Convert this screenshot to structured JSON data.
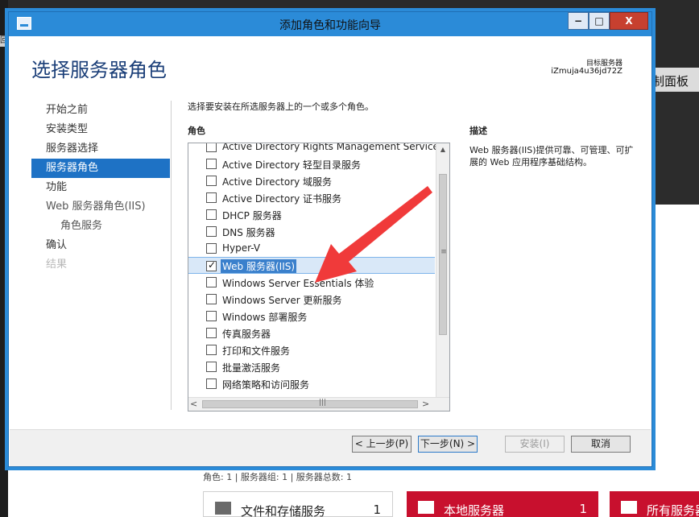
{
  "background": {
    "left_fragment": "回",
    "panel_label": "制面板",
    "summary": "角色: 1 | 服务器组: 1 | 服务器总数: 1",
    "tiles": [
      {
        "title": "文件和存储服务",
        "count": "1"
      },
      {
        "title": "本地服务器",
        "count": "1"
      },
      {
        "title": "所有服务器",
        "count": ""
      }
    ]
  },
  "window": {
    "title": "添加角色和功能向导",
    "controls": {
      "minimize": "−",
      "maximize": "□",
      "close": "X"
    }
  },
  "page": {
    "heading": "选择服务器角色",
    "target_label": "目标服务器",
    "target_name": "iZmuja4u36jd72Z"
  },
  "nav": {
    "items": [
      {
        "label": "开始之前",
        "state": "normal"
      },
      {
        "label": "安装类型",
        "state": "normal"
      },
      {
        "label": "服务器选择",
        "state": "normal"
      },
      {
        "label": "服务器角色",
        "state": "active"
      },
      {
        "label": "功能",
        "state": "normal"
      },
      {
        "label": "Web 服务器角色(IIS)",
        "state": "normal"
      },
      {
        "label": "角色服务",
        "state": "sub"
      },
      {
        "label": "确认",
        "state": "normal"
      },
      {
        "label": "结果",
        "state": "disabled"
      }
    ]
  },
  "content": {
    "instruction": "选择要安装在所选服务器上的一个或多个角色。",
    "roles_header": "角色",
    "description_header": "描述",
    "description": "Web 服务器(IIS)提供可靠、可管理、可扩展的 Web 应用程序基础结构。",
    "roles": [
      {
        "label": "Active Directory Rights Management Services",
        "checked": false
      },
      {
        "label": "Active Directory 轻型目录服务",
        "checked": false
      },
      {
        "label": "Active Directory 域服务",
        "checked": false
      },
      {
        "label": "Active Directory 证书服务",
        "checked": false
      },
      {
        "label": "DHCP 服务器",
        "checked": false
      },
      {
        "label": "DNS 服务器",
        "checked": false
      },
      {
        "label": "Hyper-V",
        "checked": false
      },
      {
        "label": "Web 服务器(IIS)",
        "checked": true
      },
      {
        "label": "Windows Server Essentials 体验",
        "checked": false
      },
      {
        "label": "Windows Server 更新服务",
        "checked": false
      },
      {
        "label": "Windows 部署服务",
        "checked": false
      },
      {
        "label": "传真服务器",
        "checked": false
      },
      {
        "label": "打印和文件服务",
        "checked": false
      },
      {
        "label": "批量激活服务",
        "checked": false
      },
      {
        "label": "网络策略和访问服务",
        "checked": false
      }
    ]
  },
  "buttons": {
    "prev": "< 上一步(P)",
    "next": "下一步(N) >",
    "install": "安装(I)",
    "cancel": "取消"
  },
  "colors": {
    "title_bar": "#2b8bd8",
    "nav_active": "#1e72c5",
    "heading": "#1a3e78",
    "annotation_arrow": "#f03a3a"
  }
}
